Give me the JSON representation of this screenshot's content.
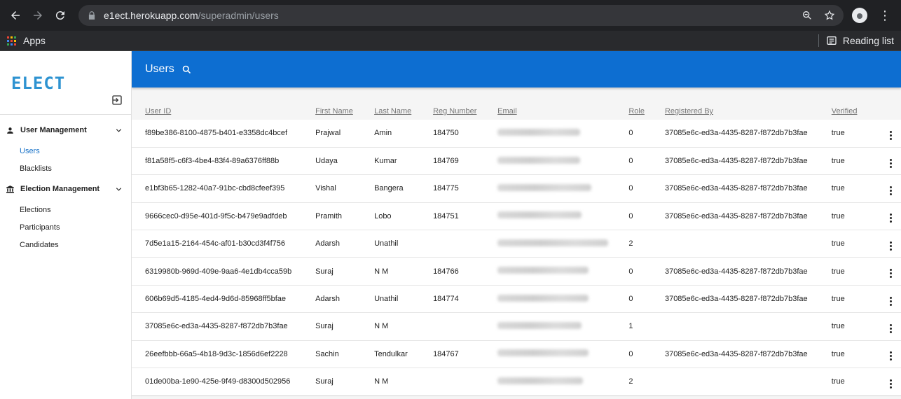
{
  "browser": {
    "url_host": "e1ect.herokuapp.com",
    "url_path": "/superadmin/users",
    "bookmark_apps": "Apps",
    "reading_list": "Reading list"
  },
  "sidebar": {
    "logo": "ELECT",
    "sections": [
      {
        "label": "User Management",
        "items": [
          "Users",
          "Blacklists"
        ]
      },
      {
        "label": "Election Management",
        "items": [
          "Elections",
          "Participants",
          "Candidates"
        ]
      }
    ]
  },
  "topbar": {
    "title": "Users"
  },
  "table": {
    "headers": {
      "user_id": "User ID",
      "first_name": "First Name",
      "last_name": "Last Name",
      "reg_number": "Reg Number",
      "email": "Email",
      "role": "Role",
      "registered_by": "Registered By",
      "verified": "Verified"
    },
    "rows": [
      {
        "user_id": "f89be386-8100-4875-b401-e3358dc4bcef",
        "first_name": "Prajwal",
        "last_name": "Amin",
        "reg_number": "184750",
        "role": "0",
        "registered_by": "37085e6c-ed3a-4435-8287-f872db7b3fae",
        "verified": "true"
      },
      {
        "user_id": "f81a58f5-c6f3-4be4-83f4-89a6376ff88b",
        "first_name": "Udaya",
        "last_name": "Kumar",
        "reg_number": "184769",
        "role": "0",
        "registered_by": "37085e6c-ed3a-4435-8287-f872db7b3fae",
        "verified": "true"
      },
      {
        "user_id": "e1bf3b65-1282-40a7-91bc-cbd8cfeef395",
        "first_name": "Vishal",
        "last_name": "Bangera",
        "reg_number": "184775",
        "role": "0",
        "registered_by": "37085e6c-ed3a-4435-8287-f872db7b3fae",
        "verified": "true"
      },
      {
        "user_id": "9666cec0-d95e-401d-9f5c-b479e9adfdeb",
        "first_name": "Pramith",
        "last_name": "Lobo",
        "reg_number": "184751",
        "role": "0",
        "registered_by": "37085e6c-ed3a-4435-8287-f872db7b3fae",
        "verified": "true"
      },
      {
        "user_id": "7d5e1a15-2164-454c-af01-b30cd3f4f756",
        "first_name": "Adarsh",
        "last_name": "Unathil",
        "reg_number": "",
        "role": "2",
        "registered_by": "",
        "verified": "true"
      },
      {
        "user_id": "6319980b-969d-409e-9aa6-4e1db4cca59b",
        "first_name": "Suraj",
        "last_name": "N M",
        "reg_number": "184766",
        "role": "0",
        "registered_by": "37085e6c-ed3a-4435-8287-f872db7b3fae",
        "verified": "true"
      },
      {
        "user_id": "606b69d5-4185-4ed4-9d6d-85968ff5bfae",
        "first_name": "Adarsh",
        "last_name": "Unathil",
        "reg_number": "184774",
        "role": "0",
        "registered_by": "37085e6c-ed3a-4435-8287-f872db7b3fae",
        "verified": "true"
      },
      {
        "user_id": "37085e6c-ed3a-4435-8287-f872db7b3fae",
        "first_name": "Suraj",
        "last_name": "N M",
        "reg_number": "",
        "role": "1",
        "registered_by": "",
        "verified": "true"
      },
      {
        "user_id": "26eefbbb-66a5-4b18-9d3c-1856d6ef2228",
        "first_name": "Sachin",
        "last_name": "Tendulkar",
        "reg_number": "184767",
        "role": "0",
        "registered_by": "37085e6c-ed3a-4435-8287-f872db7b3fae",
        "verified": "true"
      },
      {
        "user_id": "01de00ba-1e90-425e-9f49-d8300d502956",
        "first_name": "Suraj",
        "last_name": "N M",
        "reg_number": "",
        "role": "2",
        "registered_by": "",
        "verified": "true"
      }
    ]
  },
  "colors": {
    "brand_blue": "#0d6ed1",
    "logo_blue": "#2e93d1",
    "active_link": "#1a73c8"
  }
}
